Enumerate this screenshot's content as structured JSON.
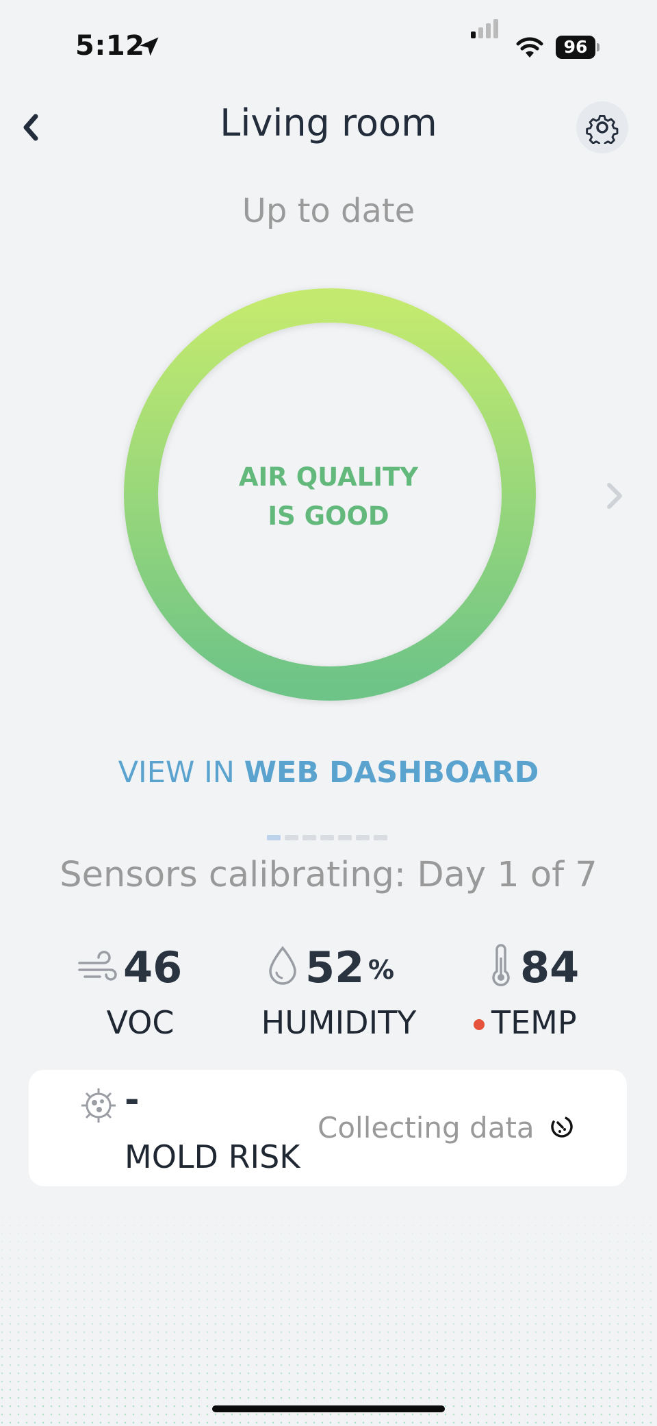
{
  "status_bar": {
    "time": "5:12",
    "battery": "96"
  },
  "header": {
    "title": "Living room"
  },
  "subtitle": "Up to date",
  "air_quality": {
    "line1": "AIR QUALITY",
    "line2": "IS GOOD",
    "color": "#62b97b"
  },
  "dashboard_link": {
    "prefix": "VIEW IN",
    "bold": "WEB DASHBOARD"
  },
  "calibration": {
    "text": "Sensors calibrating: Day 1 of 7",
    "day": 1,
    "total_days": 7
  },
  "metrics": {
    "voc": {
      "value": "46",
      "label": "VOC"
    },
    "humidity": {
      "value": "52",
      "unit": "%",
      "label": "HUMIDITY"
    },
    "temp": {
      "value": "84",
      "label": "TEMP",
      "alert_color": "#e5533d"
    }
  },
  "mold": {
    "value": "-",
    "label": "MOLD RISK",
    "status": "Collecting data"
  },
  "colors": {
    "accent_blue": "#5aa3cf",
    "ring_top": "#c3ea6e",
    "ring_bottom": "#6ec487"
  }
}
